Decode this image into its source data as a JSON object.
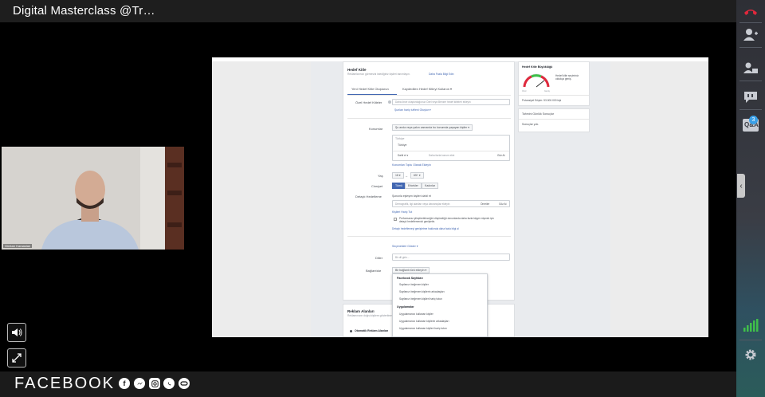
{
  "window": {
    "title": "Digital Masterclass @Tr…"
  },
  "sidebar": {
    "qa_badge": "3",
    "qa_label": "Q&A"
  },
  "presenter": {
    "name_label": "Gürkan Karaaslan"
  },
  "brand": {
    "name": "FACEBOOK"
  },
  "colors": {
    "accent": "#4267b2",
    "hangup": "#e0283c",
    "signal": "#3fbf4a"
  },
  "slide": {
    "section_title": "Hedef Kitle",
    "section_sub": "Reklamlarınızı görmesini istediğiniz kişileri tanımlayın.",
    "section_link": "Daha Fazla Bilgi Edin",
    "tabs": [
      "Yeni Hedef Kitle Oluşturun",
      "Kaydedilen Hedef Kitleyi Kullanın ▾"
    ],
    "custom_audience_label": "Özel Hedef Kitleler",
    "custom_audience_placeholder": "Daha önce oluşturduğunuz Özel veya Benzer hedef kitleleri ekleyin",
    "exclude_link": "Şunları hariç tut",
    "create_new_link": "Yeni Oluştur ▾",
    "locations_label": "Konumlar",
    "locations_select": "Şu anda veya yakın zamanda bu konumda yaşayan kişiler ▾",
    "locations_country_header": "Türkiye",
    "locations_country": "Türkiye",
    "locations_include": "Dahil et ▾",
    "locations_search_placeholder": "Daha fazla konum ekle",
    "locations_browse": "Göz At",
    "locations_bulk_link": "Konumları Toplu Olarak Ekleyin",
    "age_label": "Yaş",
    "age_min": "18 ▾",
    "age_max": "65+ ▾",
    "gender_label": "Cinsiyet",
    "gender_options": [
      "Tümü",
      "Erkekler",
      "Kadınlar"
    ],
    "detailed_label": "Detaylı Hedefleme",
    "detailed_sub": "Şununla eşleşen kişileri dahil et",
    "detailed_placeholder": "Demografik, ilgi alanları veya davranışlar ekleyin",
    "detailed_suggestions": "Öneriler",
    "detailed_browse": "Göz At",
    "exclude_people_link": "Kişileri Hariç Tut",
    "expand_text": "Performansı iyileştirebileceğini düşündüğü durumlarda daha fazla kişiye erişmek için detaylı hedeflemenizi genişletin.",
    "expand_link": "Detaylı hedeflemeyi genişletme hakkında daha fazla bilgi al",
    "more_options_link": "Seçenekleri Göster ▾",
    "languages_label": "Diller",
    "languages_placeholder": "Bir dil girin...",
    "connections_label": "Bağlantılar",
    "connections_select": "Bir bağlantı türü ekleyin ▾",
    "dropdown": {
      "group1": "Facebook Sayfaları",
      "items1": [
        "Sayfanızı beğenen kişiler",
        "Sayfanızı beğenen kişilerin arkadaşları",
        "Sayfanızı beğenen kişileri hariç tutun"
      ],
      "group2": "Uygulamalar",
      "items2": [
        "Uygulamanızı kullanan kişiler",
        "Uygulamanızı kullanan kişilerin arkadaşları",
        "Uygulamanızı kullanan kişileri hariç tutun"
      ]
    },
    "placements_title": "Reklam Alanları",
    "placements_sub": "Reklamınızın doğru kişilere gösterilmesi",
    "placements_option": "Otomatik Reklam Alanları",
    "audience_size_title": "Hedef Kitle Büyüklüğü",
    "audience_size_desc": "Hedef kitle seçiminiz oldukça geniş.",
    "gauge_left": "Özel",
    "gauge_right": "Geniş",
    "potential_reach": "Potansiyel Erişim: 53.000.000 kişi",
    "daily_results_title": "Tahmini Günlük Sonuçlar",
    "results_label": "Sonuçlar yok."
  }
}
